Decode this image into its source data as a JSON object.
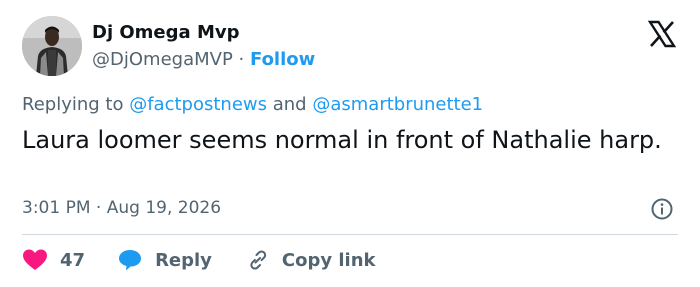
{
  "author": {
    "display_name": "Dj Omega Mvp",
    "handle": "@DjOmegaMVP",
    "separator": "·",
    "follow_label": "Follow"
  },
  "reply_context": {
    "prefix": "Replying to",
    "mention_1": "@factpostnews",
    "conjunction": "and",
    "mention_2": "@asmartbrunette1"
  },
  "tweet": {
    "text": "Laura loomer seems normal in front of Nathalie harp.",
    "time": "3:01 PM",
    "separator": "·",
    "date": "Aug 19, 2026"
  },
  "actions": {
    "like_count": "47",
    "reply_label": "Reply",
    "copy_link_label": "Copy link"
  },
  "colors": {
    "accent": "#1d9bf0",
    "like": "#f91880",
    "text": "#0f1419",
    "secondary": "#536471"
  },
  "icons": [
    "x-logo-icon",
    "info-icon",
    "heart-icon",
    "reply-bubble-icon",
    "link-icon"
  ]
}
